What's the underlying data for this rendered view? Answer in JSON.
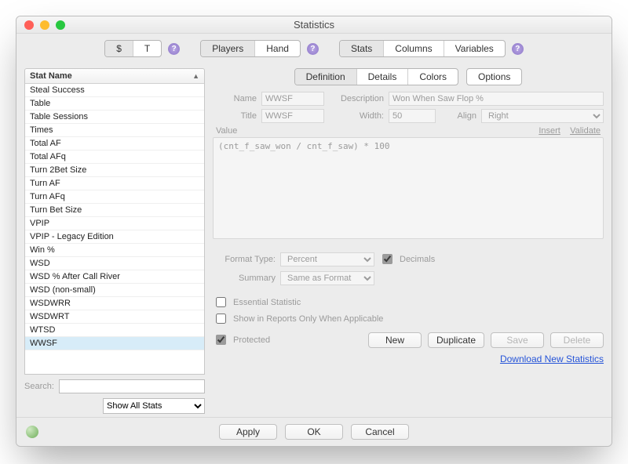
{
  "window": {
    "title": "Statistics"
  },
  "toolbar": {
    "group_mode": {
      "dollar": "$",
      "text": "T",
      "active": "$"
    },
    "scope": {
      "players": "Players",
      "hand": "Hand",
      "active": "Players"
    },
    "view": {
      "stats": "Stats",
      "columns": "Columns",
      "variables": "Variables",
      "active": "Stats"
    }
  },
  "sidebar": {
    "header": "Stat Name",
    "items": [
      "Steal Success",
      "Table",
      "Table Sessions",
      "Times",
      "Total AF",
      "Total AFq",
      "Turn 2Bet Size",
      "Turn AF",
      "Turn AFq",
      "Turn Bet Size",
      "VPIP",
      "VPIP - Legacy Edition",
      "Win %",
      "WSD",
      "WSD % After Call River",
      "WSD (non-small)",
      "WSDWRR",
      "WSDWRT",
      "WTSD",
      "WWSF"
    ],
    "selected": "WWSF",
    "search_label": "Search:",
    "search_value": "",
    "filter_options": [
      "Show All Stats"
    ],
    "filter_value": "Show All Stats"
  },
  "detail": {
    "tabs": {
      "definition": "Definition",
      "details": "Details",
      "colors": "Colors",
      "options": "Options",
      "active": "Definition"
    },
    "labels": {
      "name": "Name",
      "description": "Description",
      "title": "Title",
      "width": "Width:",
      "align": "Align",
      "value": "Value",
      "insert": "Insert",
      "validate": "Validate",
      "format_type": "Format Type:",
      "decimals": "Decimals",
      "summary": "Summary",
      "essential": "Essential Statistic",
      "show_in_reports": "Show in Reports Only When Applicable",
      "protected": "Protected"
    },
    "fields": {
      "name": "WWSF",
      "description": "Won When Saw Flop %",
      "title": "WWSF",
      "width": "50",
      "align": "Right",
      "value_expr": "(cnt_f_saw_won / cnt_f_saw) * 100",
      "format_type": "Percent",
      "decimals_checked": true,
      "summary": "Same as Format",
      "essential_checked": false,
      "show_in_reports_checked": false,
      "protected_checked": true
    },
    "buttons": {
      "new": "New",
      "duplicate": "Duplicate",
      "save": "Save",
      "delete": "Delete"
    },
    "download_link": "Download New Statistics"
  },
  "footer": {
    "apply": "Apply",
    "ok": "OK",
    "cancel": "Cancel"
  }
}
